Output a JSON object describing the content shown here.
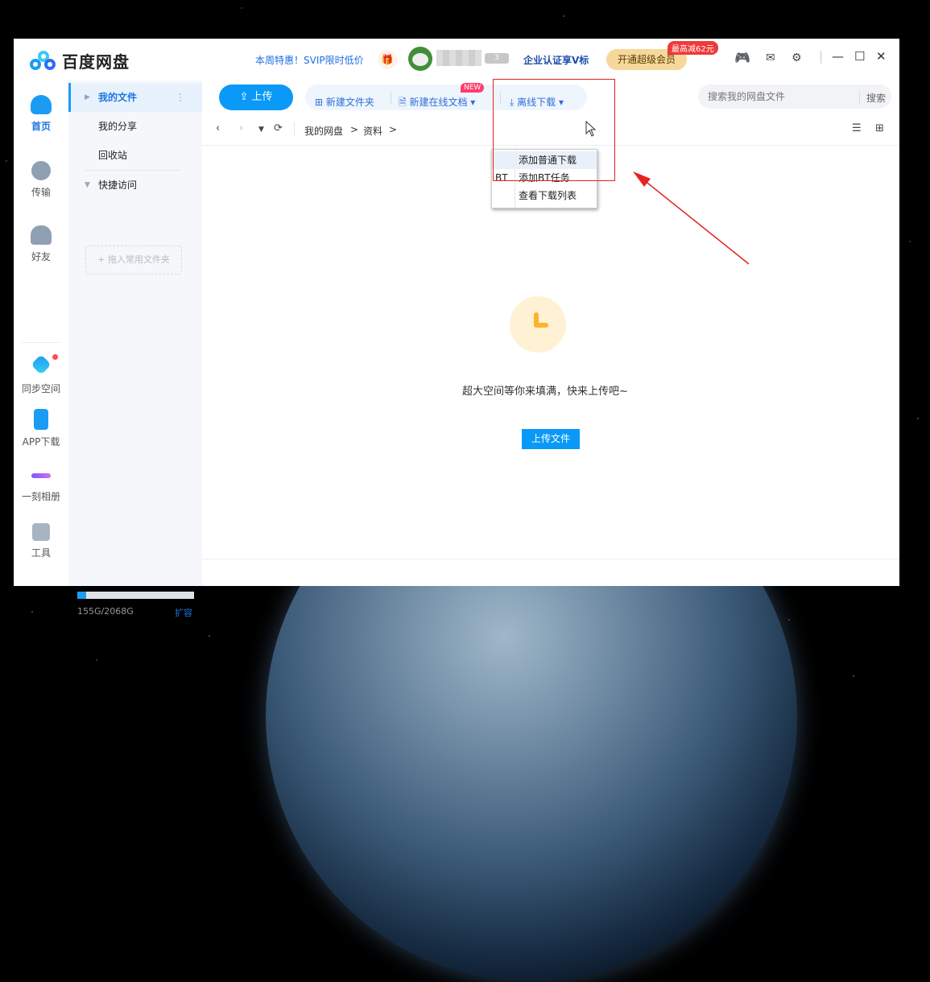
{
  "app": {
    "title": "百度网盘"
  },
  "titlebar": {
    "promo": "本周特惠！SVIP限时低价",
    "level_badge": "3",
    "enterprise": "企业认证享V标",
    "vip_button": "开通超级会员",
    "vip_tag": "最高减62元"
  },
  "leftnav": {
    "items": [
      {
        "label": "首页",
        "icon": "cloud-icon"
      },
      {
        "label": "传输",
        "icon": "transfer-icon"
      },
      {
        "label": "好友",
        "icon": "friends-icon"
      },
      {
        "label": "同步空间",
        "icon": "sync-icon"
      },
      {
        "label": "APP下载",
        "icon": "phone-icon"
      },
      {
        "label": "一刻相册",
        "icon": "album-icon"
      },
      {
        "label": "工具",
        "icon": "tools-icon"
      }
    ]
  },
  "sidebar": {
    "items": [
      {
        "label": "我的文件"
      },
      {
        "label": "我的分享"
      },
      {
        "label": "回收站"
      },
      {
        "label": "快捷访问"
      }
    ],
    "dropzone": "+ 拖入常用文件夹",
    "storage": "155G/2068G",
    "storage_fraction": 0.075,
    "expand": "扩容"
  },
  "toolbar": {
    "upload": "上传",
    "new_folder": "新建文件夹",
    "new_doc": "新建在线文档",
    "new_tag": "NEW",
    "offline": "离线下载",
    "search_placeholder": "搜索我的网盘文件",
    "search_button": "搜索"
  },
  "breadcrumb": {
    "root": "我的网盘",
    "current": "资料"
  },
  "dropdown": {
    "items": [
      {
        "label": "添加普通下载",
        "prefix": ""
      },
      {
        "label": "添加BT任务",
        "prefix": "BT"
      },
      {
        "label": "查看下载列表",
        "prefix": ""
      }
    ]
  },
  "empty": {
    "text": "超大空间等你来填满，快来上传吧~",
    "button": "上传文件"
  },
  "colors": {
    "accent": "#0a99f7",
    "annotation": "#e8221f"
  }
}
